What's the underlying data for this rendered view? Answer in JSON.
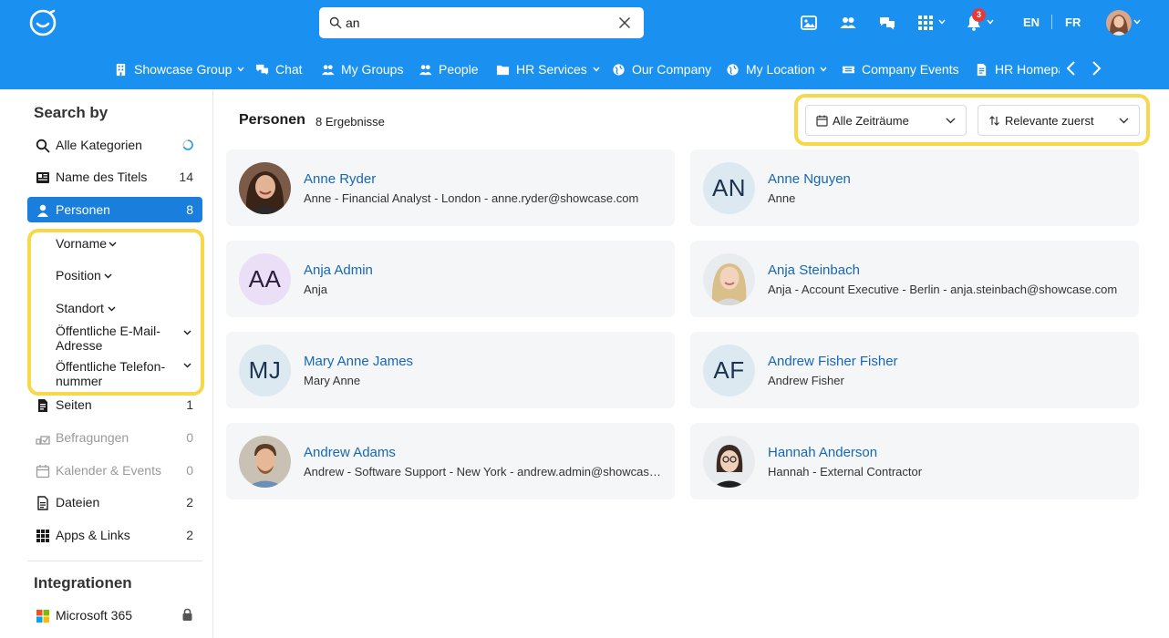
{
  "search": {
    "query": "an"
  },
  "header": {
    "notification_count": "3",
    "lang_en": "EN",
    "lang_fr": "FR"
  },
  "nav": [
    {
      "label": "Showcase Group",
      "icon": "building-icon",
      "dropdown": true
    },
    {
      "label": "Chat",
      "icon": "chat-icon",
      "dropdown": false
    },
    {
      "label": "My Groups",
      "icon": "groups-icon",
      "dropdown": false
    },
    {
      "label": "People",
      "icon": "people-icon",
      "dropdown": false
    },
    {
      "label": "HR Services",
      "icon": "folder-icon",
      "dropdown": true
    },
    {
      "label": "Our Company",
      "icon": "globe-icon",
      "dropdown": false
    },
    {
      "label": "My Location",
      "icon": "globe-icon",
      "dropdown": true
    },
    {
      "label": "Company Events",
      "icon": "ticket-icon",
      "dropdown": false
    },
    {
      "label": "HR Homepage",
      "icon": "page-icon",
      "dropdown": false
    }
  ],
  "sidebar": {
    "search_by": "Search by",
    "items": [
      {
        "label": "Alle Kategorien",
        "count": ""
      },
      {
        "label": "Name des Titels",
        "count": "14"
      },
      {
        "label": "Personen",
        "count": "8"
      },
      {
        "label": "Seiten",
        "count": "1"
      },
      {
        "label": "Befragungen",
        "count": "0"
      },
      {
        "label": "Kalender & Events",
        "count": "0"
      },
      {
        "label": "Dateien",
        "count": "2"
      },
      {
        "label": "Apps & Links",
        "count": "2"
      }
    ],
    "filters": {
      "vorname": "Vorname",
      "position": "Position",
      "standort": "Standort",
      "email_1": "Öffentliche E-Mail-",
      "email_2": "Adresse",
      "phone_1": "Öffentliche Telefon-",
      "phone_2": "nummer"
    },
    "integrations": "Integrationen",
    "integration_items": [
      {
        "label": "Microsoft 365"
      }
    ]
  },
  "results": {
    "title": "Personen",
    "count": "8 Ergebnisse",
    "time_filter": "Alle Zeiträume",
    "sort": "Relevante zuerst",
    "people": [
      {
        "name": "Anne Ryder",
        "desc": "Anne - Financial Analyst - London - anne.ryder@showcase.com",
        "initials": ""
      },
      {
        "name": "Anne Nguyen",
        "desc": "Anne",
        "initials": "AN"
      },
      {
        "name": "Anja Admin",
        "desc": "Anja",
        "initials": "AA"
      },
      {
        "name": "Anja Steinbach",
        "desc": "Anja - Account Executive - Berlin - anja.steinbach@showcase.com",
        "initials": ""
      },
      {
        "name": "Mary Anne James",
        "desc": "Mary Anne",
        "initials": "MJ"
      },
      {
        "name": "Andrew Fisher Fisher",
        "desc": "Andrew Fisher",
        "initials": "AF"
      },
      {
        "name": "Andrew Adams",
        "desc": "Andrew - Software Support - New York - andrew.admin@showcase.com",
        "initials": ""
      },
      {
        "name": "Hannah Anderson",
        "desc": "Hannah - External Contractor",
        "initials": ""
      }
    ]
  },
  "colors": {
    "brand": "#1a91f0",
    "active": "#1a7fdc",
    "link": "#1667b7",
    "highlight": "#f6d84a"
  }
}
